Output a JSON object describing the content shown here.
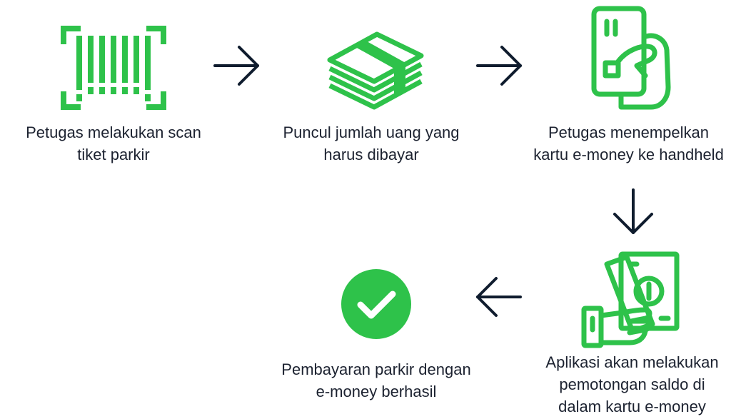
{
  "colors": {
    "accent": "#2ec24a",
    "arrow": "#0f1c2e",
    "text": "#1c2230"
  },
  "steps": [
    {
      "icon": "barcode-scan-icon",
      "label": "Petugas melakukan scan\ntiket parkir"
    },
    {
      "icon": "money-stack-icon",
      "label": "Puncul jumlah uang yang\nharus dibayar"
    },
    {
      "icon": "hand-holding-card-icon",
      "label": "Petugas menempelkan\nkartu e-money ke handheld"
    },
    {
      "icon": "hand-holding-cash-icon",
      "label": "Aplikasi akan melakukan\npemotongan saldo di\ndalam kartu e-money"
    },
    {
      "icon": "check-circle-icon",
      "label": "Pembayaran parkir dengan\ne-money berhasil"
    }
  ],
  "arrows": [
    "right",
    "right",
    "down",
    "left"
  ]
}
